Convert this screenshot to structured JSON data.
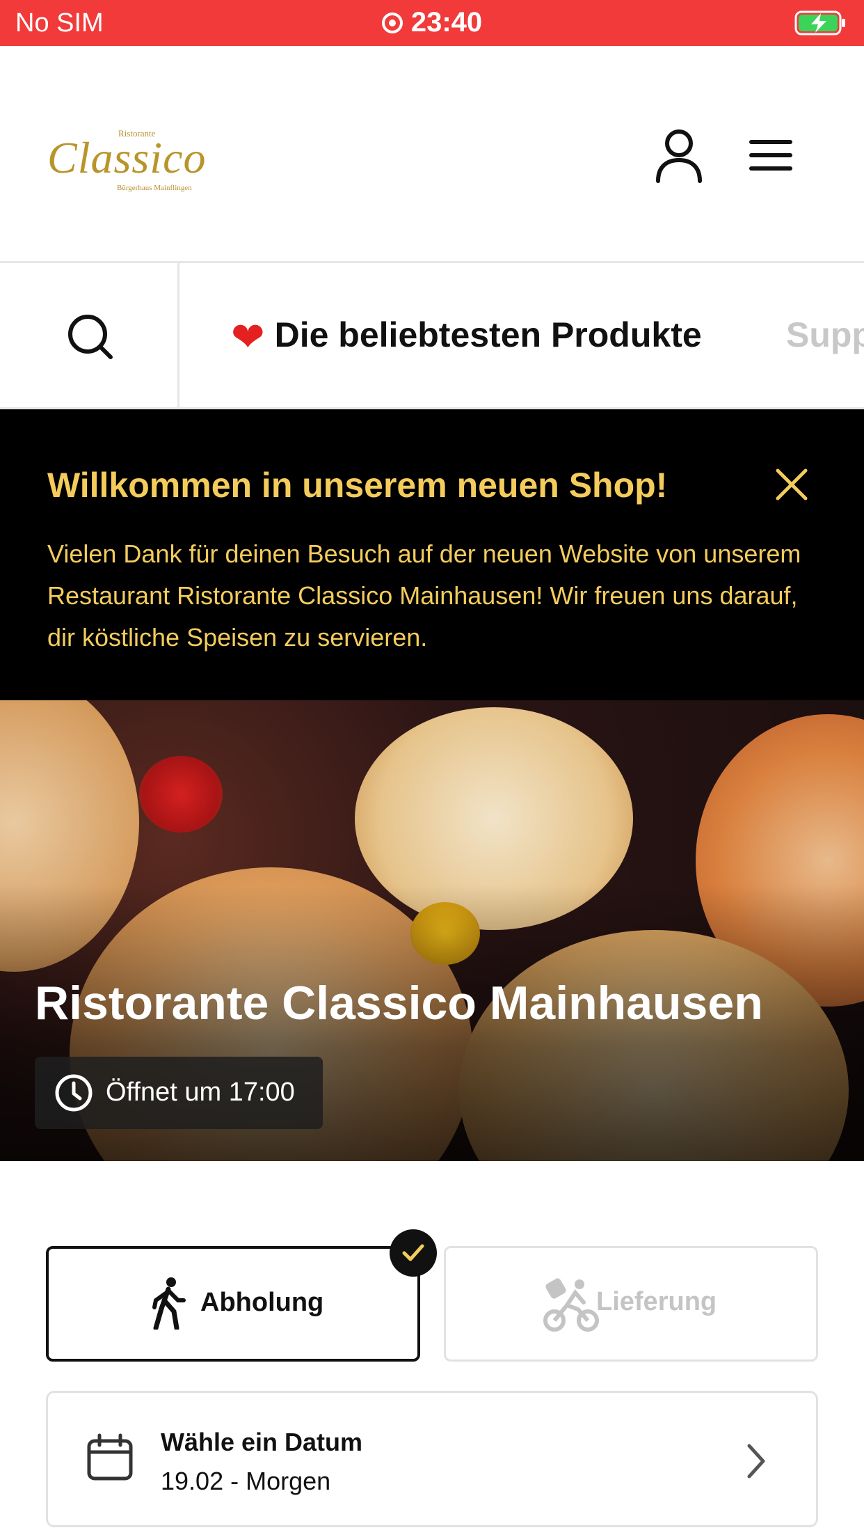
{
  "status_bar": {
    "carrier": "No SIM",
    "time": "23:40"
  },
  "header": {
    "logo": {
      "top_text": "Ristorante",
      "main_text": "Classico",
      "bottom_text": "Bürgerhaus Mainflingen"
    }
  },
  "categories": {
    "active": "Die beliebtesten Produkte",
    "next": "Supp"
  },
  "banner": {
    "title": "Willkommen in unserem neuen Shop!",
    "text": "Vielen Dank für deinen Besuch auf der neuen Website von unserem Restaurant Ristorante Classico Mainhausen! Wir freuen uns darauf, dir köstliche Speisen zu servieren."
  },
  "hero": {
    "restaurant_name": "Ristorante Classico Mainhausen",
    "opening": "Öffnet um 17:00"
  },
  "order_mode": {
    "pickup_label": "Abholung",
    "delivery_label": "Lieferung",
    "selected": "pickup"
  },
  "date_selector": {
    "title": "Wähle ein Datum",
    "value": "19.02 - Morgen"
  },
  "colors": {
    "status_bar": "#f23a3a",
    "banner_bg": "#000000",
    "banner_text": "#f4cc5c",
    "heart": "#e52020",
    "inactive_text": "#c4c4c4"
  }
}
